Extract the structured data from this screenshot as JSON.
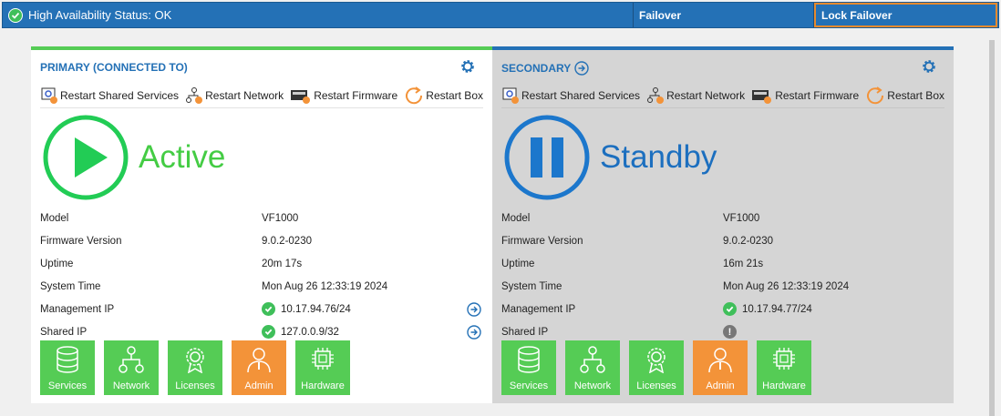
{
  "topbar": {
    "status_text": "High Availability Status: OK",
    "failover_label": "Failover",
    "lock_failover_label": "Lock Failover"
  },
  "colors": {
    "bar_blue": "#2471b6",
    "active_green": "#55cc55",
    "state_green": "#22cc55",
    "accent_orange": "#f39339",
    "lock_border": "#e58a2e"
  },
  "actions": {
    "restart_shared": "Restart Shared Services",
    "restart_network": "Restart Network",
    "restart_firmware": "Restart Firmware",
    "restart_box": "Restart Box"
  },
  "labels": {
    "model": "Model",
    "firmware": "Firmware Version",
    "uptime": "Uptime",
    "system_time": "System Time",
    "mgmt_ip": "Management IP",
    "shared_ip": "Shared IP"
  },
  "tiles": {
    "services": "Services",
    "network": "Network",
    "licenses": "Licenses",
    "admin": "Admin",
    "hardware": "Hardware"
  },
  "primary": {
    "title": "PRIMARY (CONNECTED TO)",
    "state": "Active",
    "model": "VF1000",
    "firmware": "9.0.2-0230",
    "uptime": "20m 17s",
    "system_time": "Mon Aug 26 12:33:19 2024",
    "mgmt_ip": "10.17.94.76/24",
    "shared_ip": "127.0.0.9/32"
  },
  "secondary": {
    "title": "SECONDARY",
    "state": "Standby",
    "model": "VF1000",
    "firmware": "9.0.2-0230",
    "uptime": "16m 21s",
    "system_time": "Mon Aug 26 12:33:19 2024",
    "mgmt_ip": "10.17.94.77/24",
    "shared_ip_icon": "info-icon"
  }
}
